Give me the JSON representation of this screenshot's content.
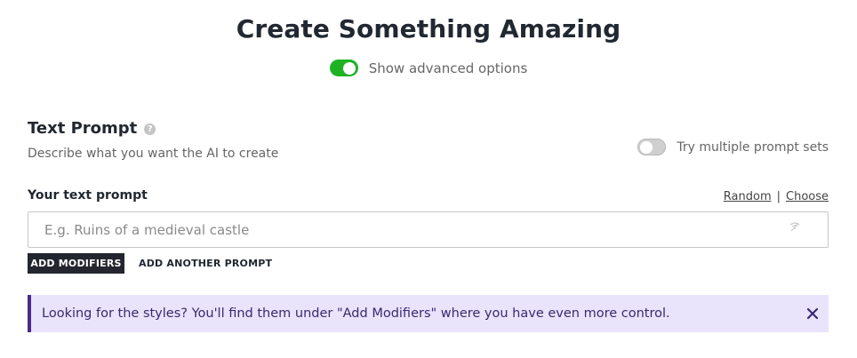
{
  "header": {
    "title": "Create Something Amazing",
    "advanced_toggle": {
      "label": "Show advanced options",
      "on": true
    }
  },
  "text_prompt": {
    "section_title": "Text Prompt",
    "description": "Describe what you want the AI to create",
    "multi_toggle": {
      "label": "Try multiple prompt sets",
      "on": false
    },
    "field_label": "Your text prompt",
    "random_link": "Random",
    "separator": "|",
    "choose_link": "Choose",
    "input": {
      "value": "",
      "placeholder": "E.g. Ruins of a medieval castle"
    },
    "add_modifiers_label": "ADD MODIFIERS",
    "add_another_label": "ADD ANOTHER PROMPT"
  },
  "banner": {
    "text": "Looking for the styles? You'll find them under \"Add Modifiers\" where you have even more control."
  },
  "colors": {
    "toggle_on": "#1db325",
    "dark_button": "#23262e",
    "banner_bg": "#e9e4fb",
    "banner_accent": "#4a2a8a"
  }
}
